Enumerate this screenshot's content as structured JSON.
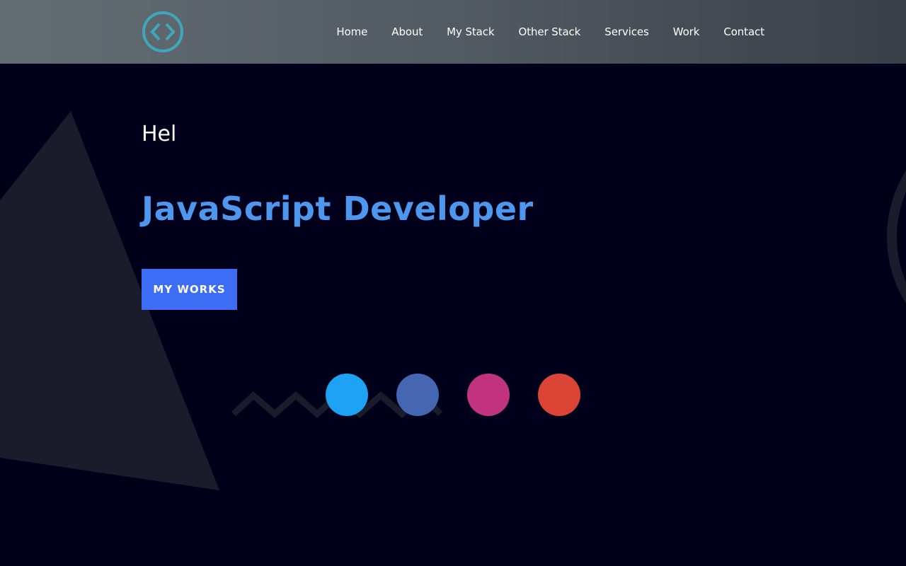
{
  "nav": {
    "logo_icon": "code-brackets-icon",
    "items": [
      "Home",
      "About",
      "My Stack",
      "Other Stack",
      "Services",
      "Work",
      "Contact"
    ]
  },
  "hero": {
    "greeting": "Hel",
    "role": "JavaScript Developer",
    "cta_label": "MY WORKS"
  },
  "social": [
    {
      "icon": "twitter-icon",
      "color": "#1da1f2"
    },
    {
      "icon": "facebook-icon",
      "color": "#4566b0"
    },
    {
      "icon": "dribbble-icon",
      "color": "#c2337f"
    },
    {
      "icon": "google-plus-icon",
      "color": "#dc4535"
    }
  ],
  "colors": {
    "background": "#00001a",
    "accent": "#3d6cf5",
    "role_text": "#4d97ee",
    "logo": "#3fa7bd"
  }
}
